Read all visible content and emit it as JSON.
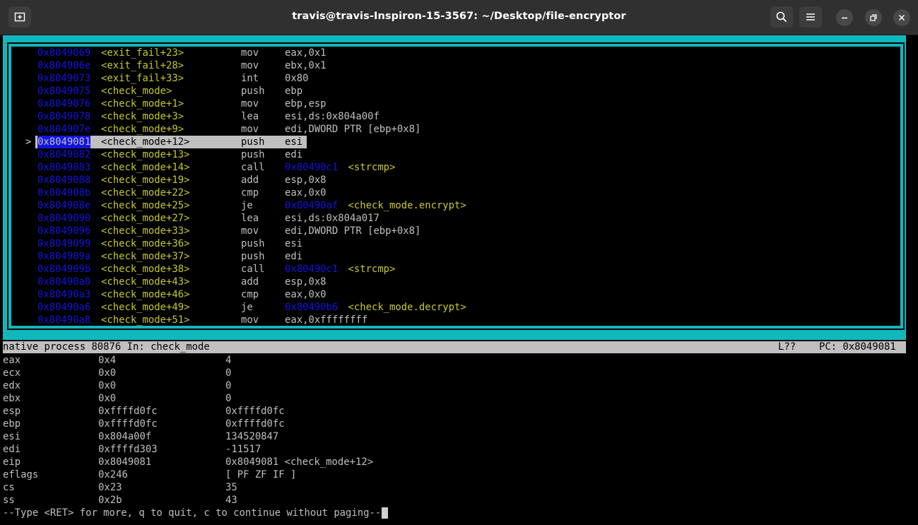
{
  "window": {
    "title": "travis@travis-Inspiron-15-3567: ~/Desktop/file-encryptor"
  },
  "icons": {
    "new_tab": "new-tab-icon",
    "search": "search-icon",
    "menu": "hamburger-menu-icon",
    "minimize": "minimize-icon",
    "maximize": "restore-icon",
    "close": "close-icon"
  },
  "asm": [
    {
      "marker": "",
      "addr": "0x8049069",
      "sym": "<exit_fail+23>",
      "op": "mov",
      "args": "eax,0x1",
      "target": ""
    },
    {
      "marker": "",
      "addr": "0x804906e",
      "sym": "<exit_fail+28>",
      "op": "mov",
      "args": "ebx,0x1",
      "target": ""
    },
    {
      "marker": "",
      "addr": "0x8049073",
      "sym": "<exit_fail+33>",
      "op": "int",
      "args": "0x80",
      "target": ""
    },
    {
      "marker": "",
      "addr": "0x8049075",
      "sym": "<check_mode>",
      "op": "push",
      "args": "ebp",
      "target": ""
    },
    {
      "marker": "",
      "addr": "0x8049076",
      "sym": "<check_mode+1>",
      "op": "mov",
      "args": "ebp,esp",
      "target": ""
    },
    {
      "marker": "",
      "addr": "0x8049078",
      "sym": "<check_mode+3>",
      "op": "lea",
      "args": "esi,ds:0x804a00f",
      "target": ""
    },
    {
      "marker": "",
      "addr": "0x804907e",
      "sym": "<check_mode+9>",
      "op": "mov",
      "args": "edi,DWORD PTR [ebp+0x8]",
      "target": ""
    },
    {
      "marker": ">",
      "addr": "0x8049081",
      "sym": "<check_mode+12>",
      "op": "push",
      "args": "esi",
      "target": "",
      "current": true
    },
    {
      "marker": "",
      "addr": "0x8049082",
      "sym": "<check_mode+13>",
      "op": "push",
      "args": "edi",
      "target": ""
    },
    {
      "marker": "",
      "addr": "0x8049083",
      "sym": "<check_mode+14>",
      "op": "call",
      "args": "0x80490c1",
      "target": "<strcmp>"
    },
    {
      "marker": "",
      "addr": "0x8049088",
      "sym": "<check_mode+19>",
      "op": "add",
      "args": "esp,0x8",
      "target": ""
    },
    {
      "marker": "",
      "addr": "0x804908b",
      "sym": "<check_mode+22>",
      "op": "cmp",
      "args": "eax,0x0",
      "target": ""
    },
    {
      "marker": "",
      "addr": "0x804908e",
      "sym": "<check_mode+25>",
      "op": "je",
      "args": "0x80490af",
      "target": "<check_mode.encrypt>"
    },
    {
      "marker": "",
      "addr": "0x8049090",
      "sym": "<check_mode+27>",
      "op": "lea",
      "args": "esi,ds:0x804a017",
      "target": ""
    },
    {
      "marker": "",
      "addr": "0x8049096",
      "sym": "<check_mode+33>",
      "op": "mov",
      "args": "edi,DWORD PTR [ebp+0x8]",
      "target": ""
    },
    {
      "marker": "",
      "addr": "0x8049099",
      "sym": "<check_mode+36>",
      "op": "push",
      "args": "esi",
      "target": ""
    },
    {
      "marker": "",
      "addr": "0x804909a",
      "sym": "<check_mode+37>",
      "op": "push",
      "args": "edi",
      "target": ""
    },
    {
      "marker": "",
      "addr": "0x804909b",
      "sym": "<check_mode+38>",
      "op": "call",
      "args": "0x80490c1",
      "target": "<strcmp>"
    },
    {
      "marker": "",
      "addr": "0x80490a0",
      "sym": "<check_mode+43>",
      "op": "add",
      "args": "esp,0x8",
      "target": ""
    },
    {
      "marker": "",
      "addr": "0x80490a3",
      "sym": "<check_mode+46>",
      "op": "cmp",
      "args": "eax,0x0",
      "target": ""
    },
    {
      "marker": "",
      "addr": "0x80490a6",
      "sym": "<check_mode+49>",
      "op": "je",
      "args": "0x80490b6",
      "target": "<check_mode.decrypt>"
    },
    {
      "marker": "",
      "addr": "0x80490a8",
      "sym": "<check_mode+51>",
      "op": "mov",
      "args": "eax,0xffffffff",
      "target": ""
    }
  ],
  "status": {
    "left": "native process 80876 In: check_mode",
    "line": "L??",
    "pc": "PC: 0x8049081"
  },
  "registers": [
    {
      "name": "eax",
      "hex": "0x4",
      "val": "4"
    },
    {
      "name": "ecx",
      "hex": "0x0",
      "val": "0"
    },
    {
      "name": "edx",
      "hex": "0x0",
      "val": "0"
    },
    {
      "name": "ebx",
      "hex": "0x0",
      "val": "0"
    },
    {
      "name": "esp",
      "hex": "0xffffd0fc",
      "val": "0xffffd0fc"
    },
    {
      "name": "ebp",
      "hex": "0xffffd0fc",
      "val": "0xffffd0fc"
    },
    {
      "name": "esi",
      "hex": "0x804a00f",
      "val": "134520847"
    },
    {
      "name": "edi",
      "hex": "0xffffd303",
      "val": "-11517"
    },
    {
      "name": "eip",
      "hex": "0x8049081",
      "val": "0x8049081 <check_mode+12>"
    },
    {
      "name": "eflags",
      "hex": "0x246",
      "val": "[ PF ZF IF ]"
    },
    {
      "name": "cs",
      "hex": "0x23",
      "val": "35"
    },
    {
      "name": "ss",
      "hex": "0x2b",
      "val": "43"
    }
  ],
  "prompt": "--Type <RET> for more, q to quit, c to continue without paging--"
}
